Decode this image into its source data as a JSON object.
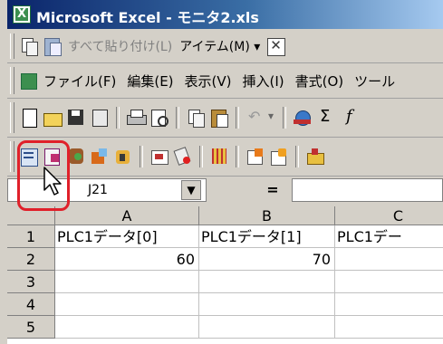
{
  "window": {
    "title": "Microsoft Excel - モニタ2.xls"
  },
  "paste_toolbar": {
    "paste_all_label": "すべて貼り付け(L)",
    "items_label": "アイテム(M) ▾"
  },
  "menu_bar": {
    "items": [
      "ファイル(F)",
      "編集(E)",
      "表示(V)",
      "挿入(I)",
      "書式(O)",
      "ツール"
    ]
  },
  "standard_toolbar": {
    "icons": [
      "new-icon",
      "open-icon",
      "save-icon",
      "permission-icon",
      "print-icon",
      "print-preview-icon",
      "copy-icon",
      "paste-icon",
      "undo-icon",
      "hyperlink-icon",
      "autosum-icon",
      "function-icon"
    ]
  },
  "addin_toolbar": {
    "icons": [
      "device-read-icon",
      "data-icon",
      "tag-icon",
      "export-icon",
      "search-icon",
      "edit-icon",
      "bug-icon",
      "settings-icon",
      "import-icon",
      "transfer-icon",
      "store-icon"
    ],
    "highlighted_icon": "device-read-icon"
  },
  "formula_bar": {
    "name_box": "J21",
    "equals": "="
  },
  "grid": {
    "columns": [
      "A",
      "B",
      "C"
    ],
    "rows": [
      {
        "row": "1",
        "cells": [
          "PLC1データ[0]",
          "PLC1データ[1]",
          "PLC1デー"
        ]
      },
      {
        "row": "2",
        "cells": [
          "60",
          "70",
          ""
        ]
      },
      {
        "row": "3",
        "cells": [
          "",
          "",
          ""
        ]
      },
      {
        "row": "4",
        "cells": [
          "",
          "",
          ""
        ]
      },
      {
        "row": "5",
        "cells": [
          "",
          "",
          ""
        ]
      }
    ]
  },
  "colors": {
    "highlight": "#e0202a",
    "titlebar": "#0a246a",
    "face": "#d4d0c8"
  }
}
